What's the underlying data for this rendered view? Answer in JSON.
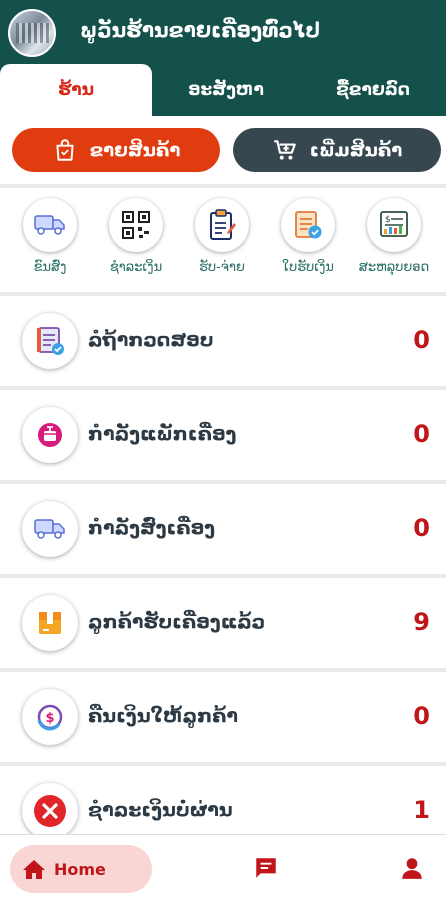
{
  "header": {
    "title": "ພູວັນຮ້ານຂາຍເຄື່ອງທົ່ວໄປ"
  },
  "tabs": [
    {
      "label": "ຮ້ານ",
      "active": true
    },
    {
      "label": "ອະສັງຫາ",
      "active": false
    },
    {
      "label": "ຊື້ຂາຍລົດ",
      "active": false
    }
  ],
  "actions": {
    "sell_label": "ຂາຍສິນຄ້າ",
    "add_label": "ເພີ່ມສິນຄ້າ"
  },
  "quick": [
    {
      "label": "ຂົນສົ່ງ",
      "icon": "delivery-truck-icon"
    },
    {
      "label": "ຊຳລະເງິນ",
      "icon": "qr-code-icon"
    },
    {
      "label": "ຮັບ-ຈ່າຍ",
      "icon": "clipboard-icon"
    },
    {
      "label": "ໃບຮັບເງິນ",
      "icon": "receipt-icon"
    },
    {
      "label": "ສະຫລຸບຍອດ",
      "icon": "summary-icon"
    }
  ],
  "orders": [
    {
      "label": "ລໍຖ້າກວດສອບ",
      "count": "0",
      "icon": "checklist-icon"
    },
    {
      "label": "ກຳລັງແພັກເຄື່ອງ",
      "count": "0",
      "icon": "package-icon"
    },
    {
      "label": "ກຳລັງສົ່ງເຄື່ອງ",
      "count": "0",
      "icon": "delivery-truck-icon"
    },
    {
      "label": "ລູກຄ້າຮັບເຄື່ອງແລ້ວ",
      "count": "9",
      "icon": "box-icon"
    },
    {
      "label": "ຄືນເງິນໃຫ້ລູກຄ້າ",
      "count": "0",
      "icon": "refund-icon"
    },
    {
      "label": "ຊຳລະເງິນບໍ່ຜ່ານ",
      "count": "1",
      "icon": "x-circle-icon"
    }
  ],
  "bottom_nav": {
    "home_label": "Home"
  },
  "colors": {
    "header": "#15514b",
    "accent": "#e13c10",
    "count": "#c0161a",
    "dark_button": "#37474f"
  }
}
